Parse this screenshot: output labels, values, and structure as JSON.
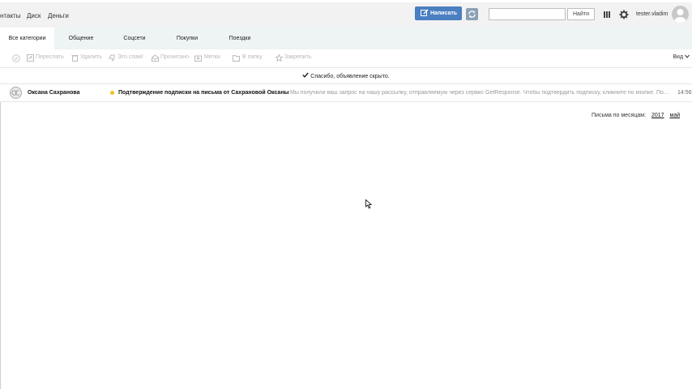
{
  "header": {
    "nav": [
      "нтакты",
      "Диск",
      "Деньги"
    ],
    "compose_label": "Написать",
    "search_placeholder": "",
    "search_button": "Найти",
    "user": "tester.vladim"
  },
  "tabs": [
    "Все категории",
    "Общение",
    "Соцсети",
    "Покупки",
    "Поездки"
  ],
  "active_tab": 0,
  "toolbar": {
    "items": [
      "Переслать",
      "Удалить",
      "Это спам!",
      "Прочитано",
      "Метки",
      "В папку",
      "Закрепить"
    ],
    "view": "Вид"
  },
  "notice": "Спасибо, объявление скрыто.",
  "messages": [
    {
      "sender": "Оксана Сахранова",
      "subject": "Подтверждение подписки на письма от Сахрановой Оксаны",
      "snippet": "Мы получили ваш запрос на нашу рассылку, отправляемую через сервис GetResponse. Чтобы подтвердить подписку, кликните по кнопке. Подтвердить",
      "time": "14:56",
      "unread_dot_color": "#f0c020"
    }
  ],
  "archive": {
    "label": "Письма по месяцам:",
    "year": "2017",
    "month": "май"
  },
  "colors": {
    "accent": "#4a7fc1",
    "tab_bar": "#eef4f4"
  }
}
